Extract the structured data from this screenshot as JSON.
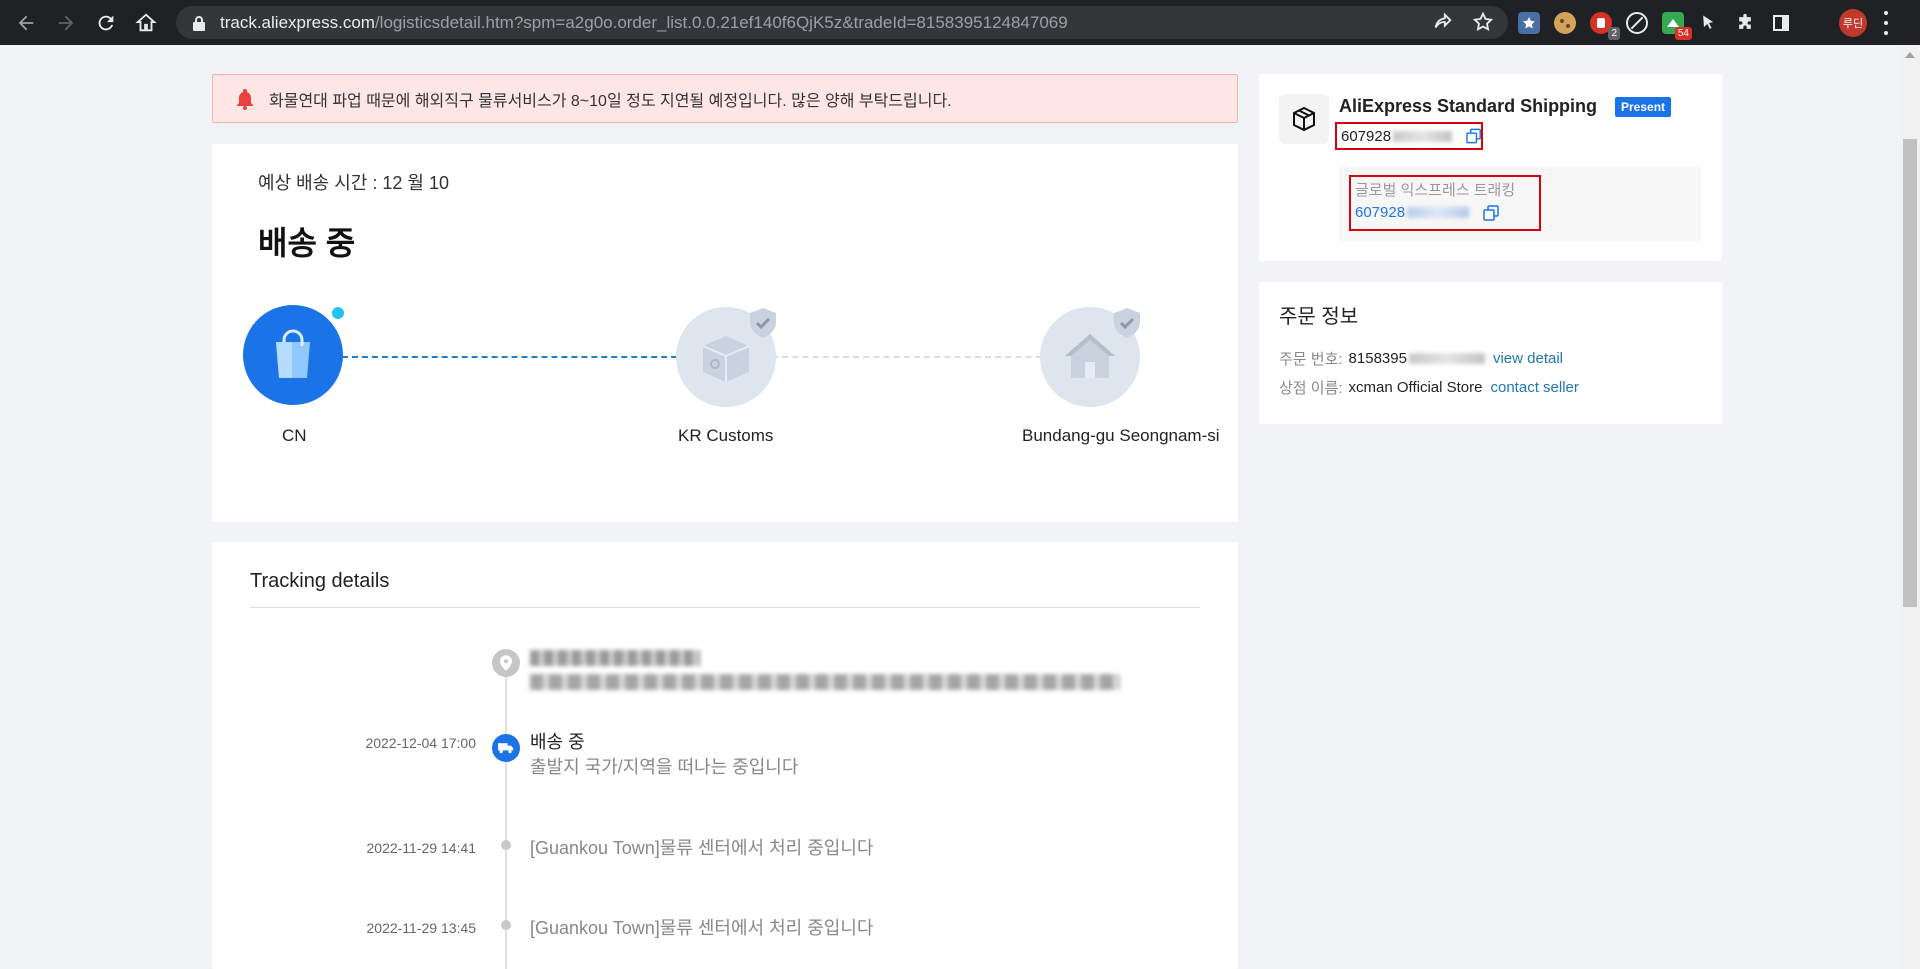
{
  "browser": {
    "url_host": "track.aliexpress.com",
    "url_path": "/logisticsdetail.htm?spm=a2g0o.order_list.0.0.21ef140f6QjK5z&tradeId=8158395124847069",
    "extensions": [
      {
        "name": "bookmark-star-icon",
        "color": "#4a6fa5",
        "badge": ""
      },
      {
        "name": "cookie-icon",
        "color": "#d4a35a",
        "badge": ""
      },
      {
        "name": "shield-ext-icon",
        "color": "#d93025",
        "badge": "2"
      },
      {
        "name": "block-icon",
        "color": "#e8eaed",
        "badge": ""
      },
      {
        "name": "price-ext-icon",
        "color": "#34a853",
        "badge": "54"
      },
      {
        "name": "cursor-ext-icon",
        "color": "#e8eaed",
        "badge": ""
      }
    ],
    "profile_label": "루딘"
  },
  "alert": {
    "message": "화물연대 파업 때문에 해외직구 물류서비스가 8~10일 정도 지연될 예정입니다. 많은 양해 부탁드립니다."
  },
  "status": {
    "eta_label": "예상 배송 시간 : 12 월 10",
    "title": "배송 중",
    "steps": [
      {
        "label": "CN"
      },
      {
        "label": "KR Customs"
      },
      {
        "label": "Bundang-gu Seongnam-si"
      }
    ]
  },
  "tracking": {
    "title": "Tracking details",
    "events": [
      {
        "time": "2022-12-04 17:00",
        "title": "배송 중",
        "desc": "출발지 국가/지역을 떠나는 중입니다"
      },
      {
        "time": "2022-11-29 14:41",
        "desc": "[Guankou Town]물류 센터에서 처리 중입니다"
      },
      {
        "time": "2022-11-29 13:45",
        "desc": "[Guankou Town]물류 센터에서 처리 중입니다"
      }
    ]
  },
  "shipping": {
    "name": "AliExpress Standard Shipping",
    "badge": "Present",
    "tracking_number_prefix": "607928",
    "global_label": "글로벌 익스프레스 트래킹",
    "global_number_prefix": "607928"
  },
  "order": {
    "title": "주문 정보",
    "number_label": "주문 번호:",
    "number_prefix": "8158395",
    "view_detail": "view detail",
    "store_label": "상점 이름:",
    "store_name": "xcman Official Store",
    "contact_seller": "contact seller"
  },
  "colors": {
    "accent": "#1a74e8",
    "alert_bg": "#ffe6e6",
    "highlight_box": "#d8000c"
  }
}
